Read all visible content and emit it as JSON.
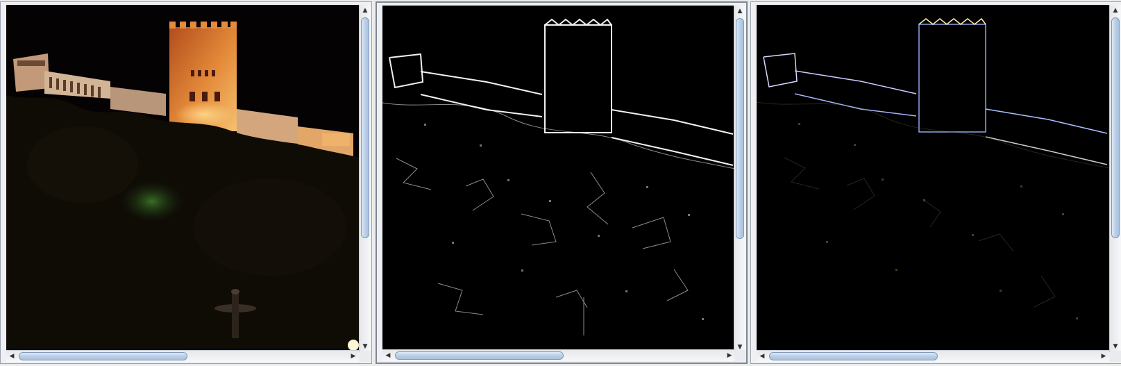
{
  "panels": [
    {
      "id": "original",
      "image": {
        "kind": "photo",
        "subject": "illuminated castle tower at night"
      },
      "vscroll": {
        "position": 0.0,
        "visible_fraction": 0.66
      },
      "hscroll": {
        "position": 0.0,
        "visible_fraction": 0.5
      }
    },
    {
      "id": "edges-grayscale",
      "image": {
        "kind": "edge-map",
        "subject": "castle tower edge detection (white on black)"
      },
      "vscroll": {
        "position": 0.0,
        "visible_fraction": 0.66
      },
      "hscroll": {
        "position": 0.0,
        "visible_fraction": 0.5
      }
    },
    {
      "id": "edges-color",
      "image": {
        "kind": "color-edge-map",
        "subject": "castle tower color edge detection"
      },
      "vscroll": {
        "position": 0.0,
        "visible_fraction": 0.66
      },
      "hscroll": {
        "position": 0.0,
        "visible_fraction": 0.5
      }
    }
  ],
  "icons": {
    "scroll_up": "▲",
    "scroll_down": "▼",
    "scroll_left": "◀",
    "scroll_right": "▶"
  },
  "colors": {
    "window_bg": "#ececec",
    "scroll_thumb": "#b8cde6",
    "tower_glow": "#d9782a"
  }
}
